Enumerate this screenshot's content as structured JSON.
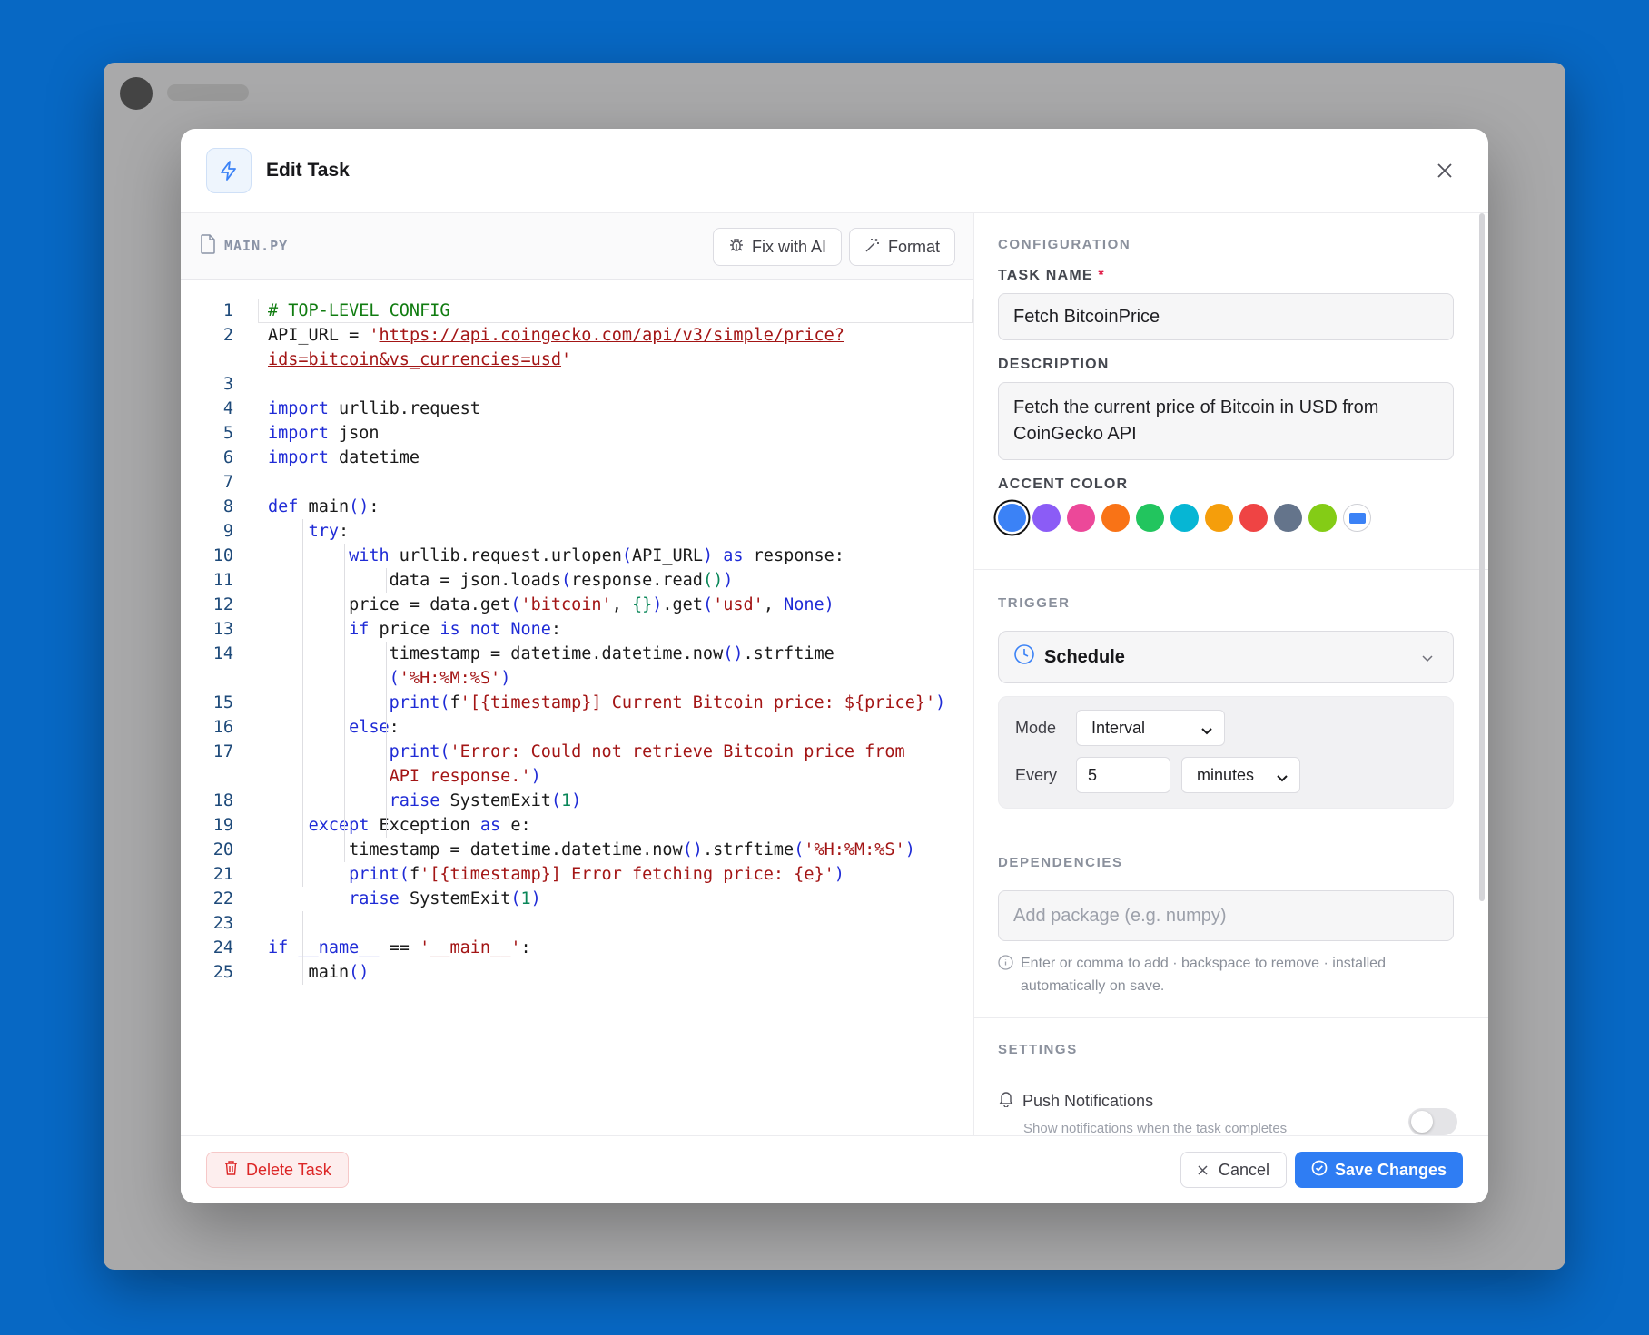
{
  "modal": {
    "title": "Edit Task"
  },
  "editor": {
    "file_name": "MAIN.PY",
    "fix_label": "Fix with AI",
    "format_label": "Format",
    "lines": [
      {
        "n": "1",
        "html": "<span class=\"cm\"># TOP-LEVEL CONFIG</span>"
      },
      {
        "n": "2",
        "html": "API_URL = <span class=\"str\">'</span><span class=\"url\">https://api.coingecko.com/api/v3/simple/price?</span>"
      },
      {
        "n": "",
        "html": "<span class=\"url\">ids=bitcoin&amp;vs_currencies=usd</span><span class=\"str\">'</span>"
      },
      {
        "n": "3",
        "html": ""
      },
      {
        "n": "4",
        "html": "<span class=\"kw\">import</span> urllib.request"
      },
      {
        "n": "5",
        "html": "<span class=\"kw\">import</span> json"
      },
      {
        "n": "6",
        "html": "<span class=\"kw\">import</span> datetime"
      },
      {
        "n": "7",
        "html": ""
      },
      {
        "n": "8",
        "html": "<span class=\"kw\">def</span> main<span class=\"kw\">()</span>:"
      },
      {
        "n": "9",
        "html": "    <span class=\"kw\">try</span>:"
      },
      {
        "n": "10",
        "html": "        <span class=\"kw\">with</span> urllib.request.urlopen<span class=\"kw\">(</span>API_URL<span class=\"kw\">)</span> <span class=\"kw\">as</span> response:"
      },
      {
        "n": "11",
        "html": "            data = json.loads<span class=\"kw\">(</span>response.read<span class=\"num\">()</span><span class=\"kw\">)</span>"
      },
      {
        "n": "12",
        "html": "        price = data.get<span class=\"kw\">(</span><span class=\"str\">'bitcoin'</span>, <span class=\"num\">{}</span><span class=\"kw\">)</span>.get<span class=\"kw\">(</span><span class=\"str\">'usd'</span>, <span class=\"kw\">None)</span>"
      },
      {
        "n": "13",
        "html": "        <span class=\"kw\">if</span> price <span class=\"kw\">is not None</span>:"
      },
      {
        "n": "14",
        "html": "            timestamp = datetime.datetime.now<span class=\"kw\">()</span>.strftime"
      },
      {
        "n": "",
        "html": "            <span class=\"kw\">(</span><span class=\"str\">'%H:%M:%S'</span><span class=\"kw\">)</span>"
      },
      {
        "n": "15",
        "html": "            <span class=\"kw\">print(</span>f<span class=\"str\">'[{timestamp}] Current Bitcoin price: ${price}'</span><span class=\"kw\">)</span>"
      },
      {
        "n": "16",
        "html": "        <span class=\"kw\">else</span>:"
      },
      {
        "n": "17",
        "html": "            <span class=\"kw\">print(</span><span class=\"str\">'Error: Could not retrieve Bitcoin price from</span>"
      },
      {
        "n": "",
        "html": "            <span class=\"str\">API response.'</span><span class=\"kw\">)</span>"
      },
      {
        "n": "18",
        "html": "            <span class=\"kw\">raise</span> SystemExit<span class=\"kw\">(</span><span class=\"num\">1</span><span class=\"kw\">)</span>"
      },
      {
        "n": "19",
        "html": "    <span class=\"kw\">except</span> Exception <span class=\"kw\">as</span> e:"
      },
      {
        "n": "20",
        "html": "        timestamp = datetime.datetime.now<span class=\"kw\">()</span>.strftime<span class=\"kw\">(</span><span class=\"str\">'%H:%M:%S'</span><span class=\"kw\">)</span>"
      },
      {
        "n": "21",
        "html": "        <span class=\"kw\">print(</span>f<span class=\"str\">'[{timestamp}] Error fetching price: {e}'</span><span class=\"kw\">)</span>"
      },
      {
        "n": "22",
        "html": "        <span class=\"kw\">raise</span> SystemExit<span class=\"kw\">(</span><span class=\"num\">1</span><span class=\"kw\">)</span>"
      },
      {
        "n": "23",
        "html": ""
      },
      {
        "n": "24",
        "html": "<span class=\"kw\">if</span> <span class=\"kw\">__name__</span> == <span class=\"str\">'__main__'</span>:"
      },
      {
        "n": "25",
        "html": "    main<span class=\"kw\">()</span>"
      }
    ]
  },
  "config": {
    "section_title": "CONFIGURATION",
    "task_name_label": "TASK NAME",
    "task_name_required": "*",
    "task_name_value": "Fetch BitcoinPrice",
    "description_label": "DESCRIPTION",
    "description_value": "Fetch the current price of Bitcoin in USD from CoinGecko API",
    "accent_label": "ACCENT COLOR",
    "accent_colors": [
      "#3b82f6",
      "#8b5cf6",
      "#ec4899",
      "#f97316",
      "#22c55e",
      "#06b6d4",
      "#f59e0b",
      "#ef4444",
      "#64748b",
      "#84cc16"
    ],
    "selected_accent": "#3b82f6"
  },
  "trigger": {
    "section_title": "TRIGGER",
    "type": "Schedule",
    "mode_label": "Mode",
    "mode_value": "Interval",
    "every_label": "Every",
    "every_value": "5",
    "unit_value": "minutes"
  },
  "dependencies": {
    "section_title": "DEPENDENCIES",
    "placeholder": "Add package (e.g. numpy)",
    "hint": "Enter or comma to add · backspace to remove · installed automatically on save."
  },
  "settings": {
    "section_title": "SETTINGS",
    "push_label": "Push Notifications",
    "push_desc": "Show notifications when the task completes",
    "push_enabled": false
  },
  "footer": {
    "delete_label": "Delete Task",
    "cancel_label": "Cancel",
    "save_label": "Save Changes"
  }
}
